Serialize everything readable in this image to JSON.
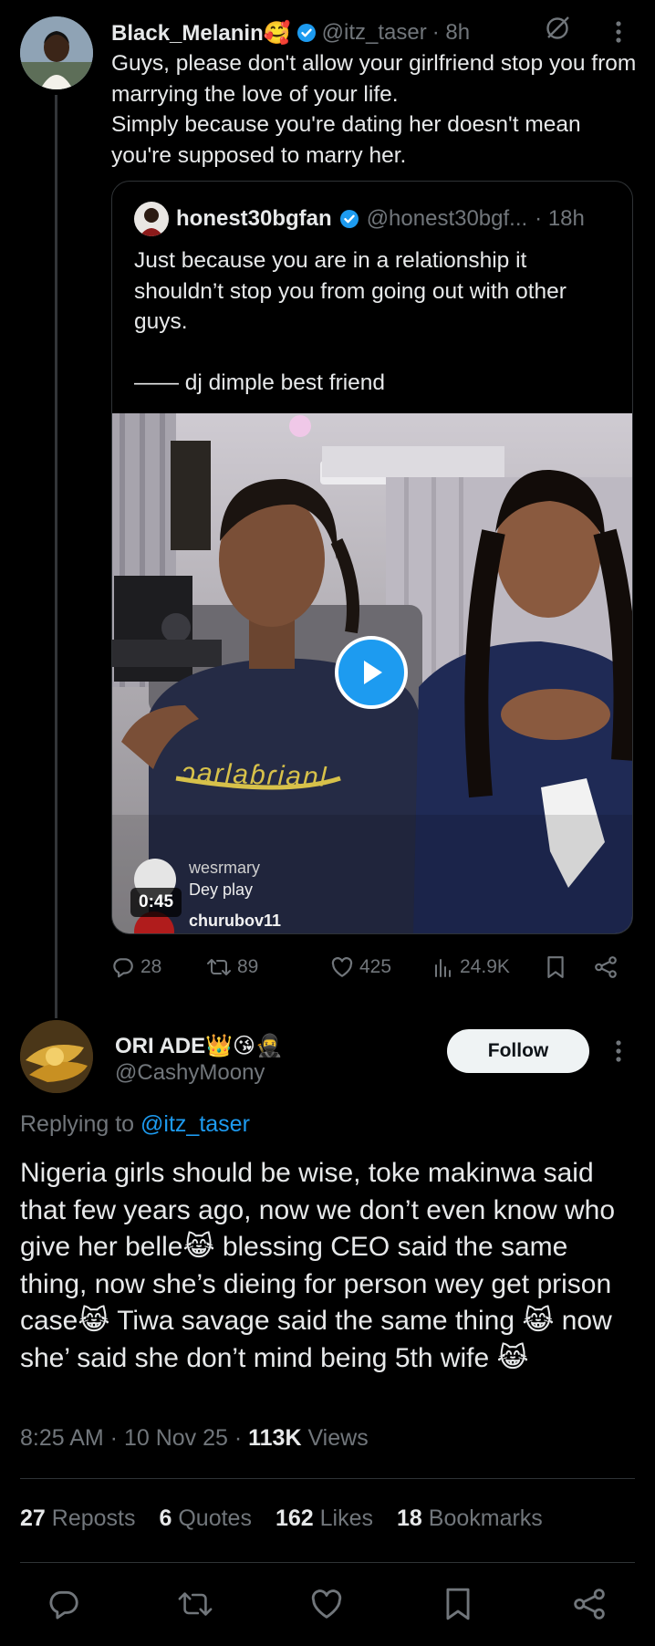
{
  "parent": {
    "display_name": "Black_Melanin🥰",
    "handle": "@itz_taser",
    "time": "· 8h",
    "text": "Guys, please don't allow your girlfriend stop you from marrying the love of your life.\nSimply because you're dating her doesn't mean you're supposed to marry her.",
    "quote": {
      "display_name": "honest30bgfan",
      "handle": "@honest30bgf...",
      "time": "· 18h",
      "text": "Just because you are in a relationship it shouldn’t stop you from going out with other guys.\n\n—— dj dimple best friend",
      "video": {
        "duration": "0:45",
        "shirt_text": "ɔarlaɓɾianl",
        "overlay_comments": [
          {
            "user": "wesrmary",
            "text": "Dey play"
          },
          {
            "user": "churubov11",
            "text": ""
          }
        ]
      }
    },
    "actions": {
      "replies": "28",
      "reposts": "89",
      "likes": "425",
      "views": "24.9K"
    }
  },
  "reply": {
    "display_name": "ORI ADE👑😘🥷",
    "handle": "@CashyMoony",
    "follow_label": "Follow",
    "replying_prefix": "Replying to",
    "replying_handle": "@itz_taser",
    "text": "Nigeria girls should be wise, toke makinwa said that few years ago, now we don’t even know who give her belle😹 blessing CEO said the same thing, now she’s dieing for person wey get prison case😹 Tiwa savage said the same thing 😹 now she’ said she don’t mind being 5th wife 😹",
    "time": "8:25 AM · 10 Nov 25 · ",
    "views_count": "113K",
    "views_label": " Views",
    "stats": [
      {
        "count": "27",
        "label": "Reposts"
      },
      {
        "count": "6",
        "label": "Quotes"
      },
      {
        "count": "162",
        "label": "Likes"
      },
      {
        "count": "18",
        "label": "Bookmarks"
      }
    ]
  },
  "colors": {
    "accent": "#1d9bf0",
    "muted": "#71767b",
    "text": "#e7e9ea",
    "background": "#000000",
    "border": "#2f3336"
  }
}
